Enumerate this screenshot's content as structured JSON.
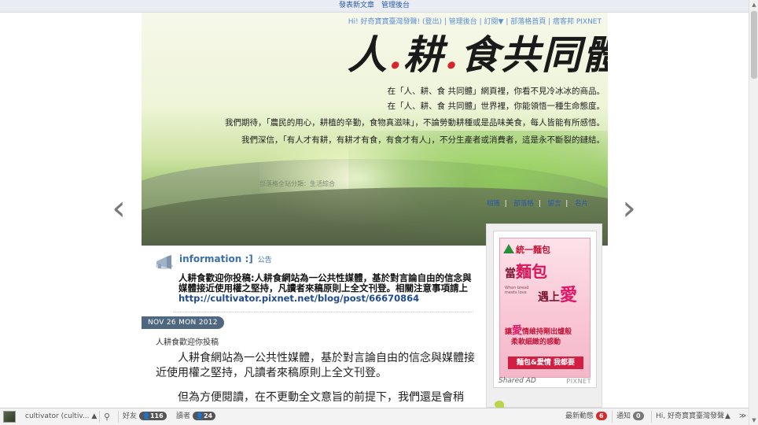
{
  "topbar": {
    "new_post": "發表新文章",
    "admin": "管理後台"
  },
  "banner": {
    "user_links": "Hi! 好奇寶寶臺灣發聲! (登出) | 管理後台 | 訂閱▼ | 部落格首頁 | 痞客邦 PIXNET",
    "title_part1": "人",
    "title_part2": "耕",
    "title_part3": "食共同體",
    "slogan1": "在「人、耕、食 共同體」網頁裡，你看不見冷冰冰的商品。",
    "slogan2": "在「人、耕、食 共同體」世界裡，你能領悟一種生命態度。",
    "slogan3": "我們期待，「農民的用心，耕植的辛勤，食物真滋味」，不論勞動耕種或是品味美食，每人皆能有所感悟。",
    "slogan4": "我們深信，「有人才有耕，有耕才有食，有食才有人」，不分生產者或消費者，這是永不斷裂的鏈結。",
    "category": "部落格全站分類：生活綜合",
    "nav": [
      "相簿",
      "部落格",
      "留言",
      "名片"
    ]
  },
  "notice": {
    "title": "information :]",
    "tag": "公告",
    "text": "人耕食歡迎你投稿:人耕食網站為一公共性媒體，基於對言論自由的信念與媒體接近使用權之堅持，凡讀者來稿原則上全文刊登。相關注意事項請上",
    "url": "http://cultivator.pixnet.net/blog/post/66670864"
  },
  "post": {
    "date": "NOV 26 MON 2012",
    "title": "人耕食歡迎你投稿",
    "para1": "人耕食網站為一公共性媒體，基於對言論自由的信念與媒體接近使用權之堅持，凡讀者來稿原則上全文刊登。",
    "para2": "但為方便閱讀，在不更動全文意旨的前提下，我們還是會稍"
  },
  "ad": {
    "brand": "統一麵包",
    "slogan1_a": "當",
    "slogan1_b": "麵包",
    "slogan2_a": "遇上",
    "slogan2_b": "愛",
    "small_text": "When bread meets love",
    "line3_a": "讓",
    "line3_b": "愛",
    "line3_c": "情",
    "line3_d": "維持剛出爐般",
    "line4": "柔軟細緻的感動",
    "button": "麵包&愛情 我都要",
    "footer_left": "Shared AD",
    "footer_right": "PIXNET"
  },
  "bottombar": {
    "user": "cultivator (cultiv...",
    "user_caret": "▲",
    "friends_label": "好友",
    "friends_count": "116",
    "readers_label": "讀者",
    "readers_count": "24",
    "activity_label": "最新動態",
    "activity_count": "6",
    "notify_label": "通知",
    "notify_count": "0",
    "hi_text": "Hi, 好奇寶寶臺灣發聲",
    "expand": "▲",
    "collapse": "≫"
  },
  "colors": {
    "link_blue": "#2a5aa8",
    "date_badge": "#4f6880",
    "accent_red": "#d52b2b"
  }
}
